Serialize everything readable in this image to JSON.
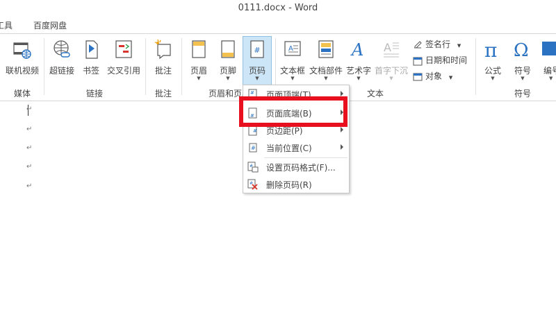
{
  "window": {
    "title": "0111.docx - Word"
  },
  "tabs": [
    "工具",
    "百度网盘"
  ],
  "ribbon": {
    "media": {
      "online_video": "联机视频",
      "group": "媒体"
    },
    "links": {
      "hyperlink": "超链接",
      "bookmark": "书签",
      "cross_ref": "交叉引用",
      "group": "链接"
    },
    "comments": {
      "comment": "批注",
      "group": "批注"
    },
    "header_footer": {
      "header": "页眉",
      "footer": "页脚",
      "page_number": "页码",
      "group": "页眉和页脚"
    },
    "text": {
      "textbox": "文本框",
      "quick_parts": "文档部件",
      "wordart": "艺术字",
      "dropcap": "首字下沉",
      "signature_line": "签名行",
      "date_time": "日期和时间",
      "object": "对象",
      "group": "文本"
    },
    "symbols": {
      "equation": "公式",
      "symbol": "符号",
      "numbering": "编号",
      "group": "符号"
    }
  },
  "page_menu": {
    "items": [
      {
        "label": "页面顶端(T)",
        "has_submenu": true
      },
      {
        "label": "页面底端(B)",
        "has_submenu": true
      },
      {
        "label": "页边距(P)",
        "has_submenu": true
      },
      {
        "label": "当前位置(C)",
        "has_submenu": true
      },
      {
        "label": "设置页码格式(F)...",
        "has_submenu": false
      },
      {
        "label": "删除页码(R)",
        "has_submenu": false
      }
    ]
  },
  "document": {
    "paragraph_mark": "↵"
  },
  "colors": {
    "highlight": "#e8101e",
    "selected_button": "#cde6f7",
    "icon_blue": "#2b73c2"
  }
}
